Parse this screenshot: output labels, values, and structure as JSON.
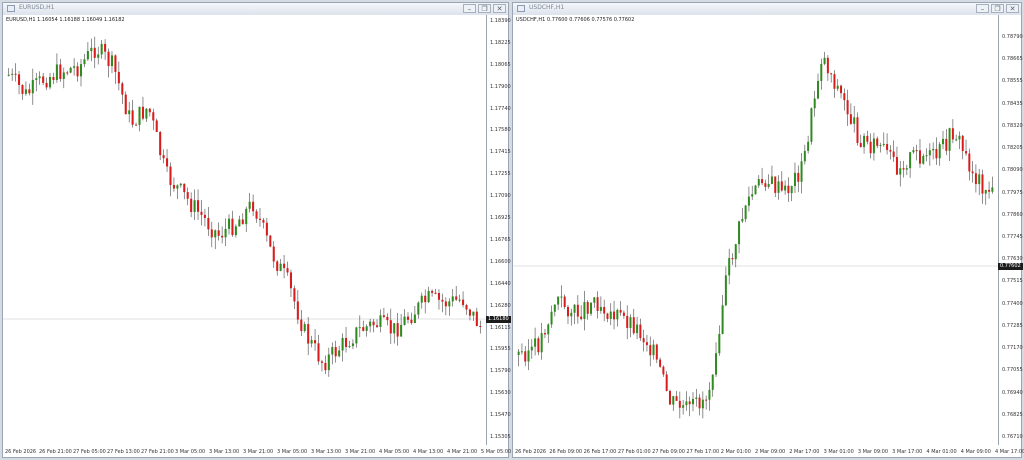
{
  "windows": [
    {
      "id": "eurusd",
      "title": "EURUSD,H1",
      "symbol_line": "EURUSD,H1  1.16054 1.16188 1.16049 1.16182",
      "buttons": {
        "minimize": "–",
        "restore": "❐",
        "close": "✕"
      },
      "current_price": "1.16180",
      "price_ticks": [
        "1.18390",
        "1.18225",
        "1.18065",
        "1.17900",
        "1.17740",
        "1.17580",
        "1.17415",
        "1.17255",
        "1.17090",
        "1.16925",
        "1.16765",
        "1.16600",
        "1.16440",
        "1.16280",
        "1.16115",
        "1.15955",
        "1.15790",
        "1.15630",
        "1.15470",
        "1.15305"
      ],
      "time_ticks": [
        "26 Feb 2026",
        "26 Feb 21:00",
        "27 Feb 05:00",
        "27 Feb 13:00",
        "27 Feb 21:00",
        "3 Mar 05:00",
        "3 Mar 13:00",
        "3 Mar 21:00",
        "3 Mar 05:00",
        "3 Mar 13:00",
        "3 Mar 21:00",
        "4 Mar 05:00",
        "4 Mar 13:00",
        "4 Mar 21:00",
        "5 Mar 05:00"
      ]
    },
    {
      "id": "usdchf",
      "title": "USDCHF,H1",
      "symbol_line": "USDCHF,H1  0.77600 0.77606 0.77576 0.77602",
      "buttons": {
        "minimize": "–",
        "restore": "❐",
        "close": "✕"
      },
      "current_price": "0.77602",
      "price_ticks": [
        "0.78790",
        "0.78665",
        "0.78555",
        "0.78435",
        "0.78320",
        "0.78205",
        "0.78090",
        "0.77975",
        "0.77860",
        "0.77745",
        "0.77630",
        "0.77515",
        "0.77400",
        "0.77285",
        "0.77170",
        "0.77055",
        "0.76940",
        "0.76825",
        "0.76710"
      ],
      "time_ticks": [
        "26 Feb 2026",
        "26 Feb 09:00",
        "26 Feb 17:00",
        "27 Feb 01:00",
        "27 Feb 09:00",
        "27 Feb 17:00",
        "2 Mar 01:00",
        "2 Mar 09:00",
        "2 Mar 17:00",
        "3 Mar 01:00",
        "3 Mar 09:00",
        "3 Mar 17:00",
        "4 Mar 01:00",
        "4 Mar 09:00",
        "4 Mar 17:00"
      ]
    }
  ],
  "colors": {
    "bull": "#2e8b1f",
    "bear": "#d81c1c",
    "background": "#ffffff",
    "price_line": "#c0c4c8"
  }
}
